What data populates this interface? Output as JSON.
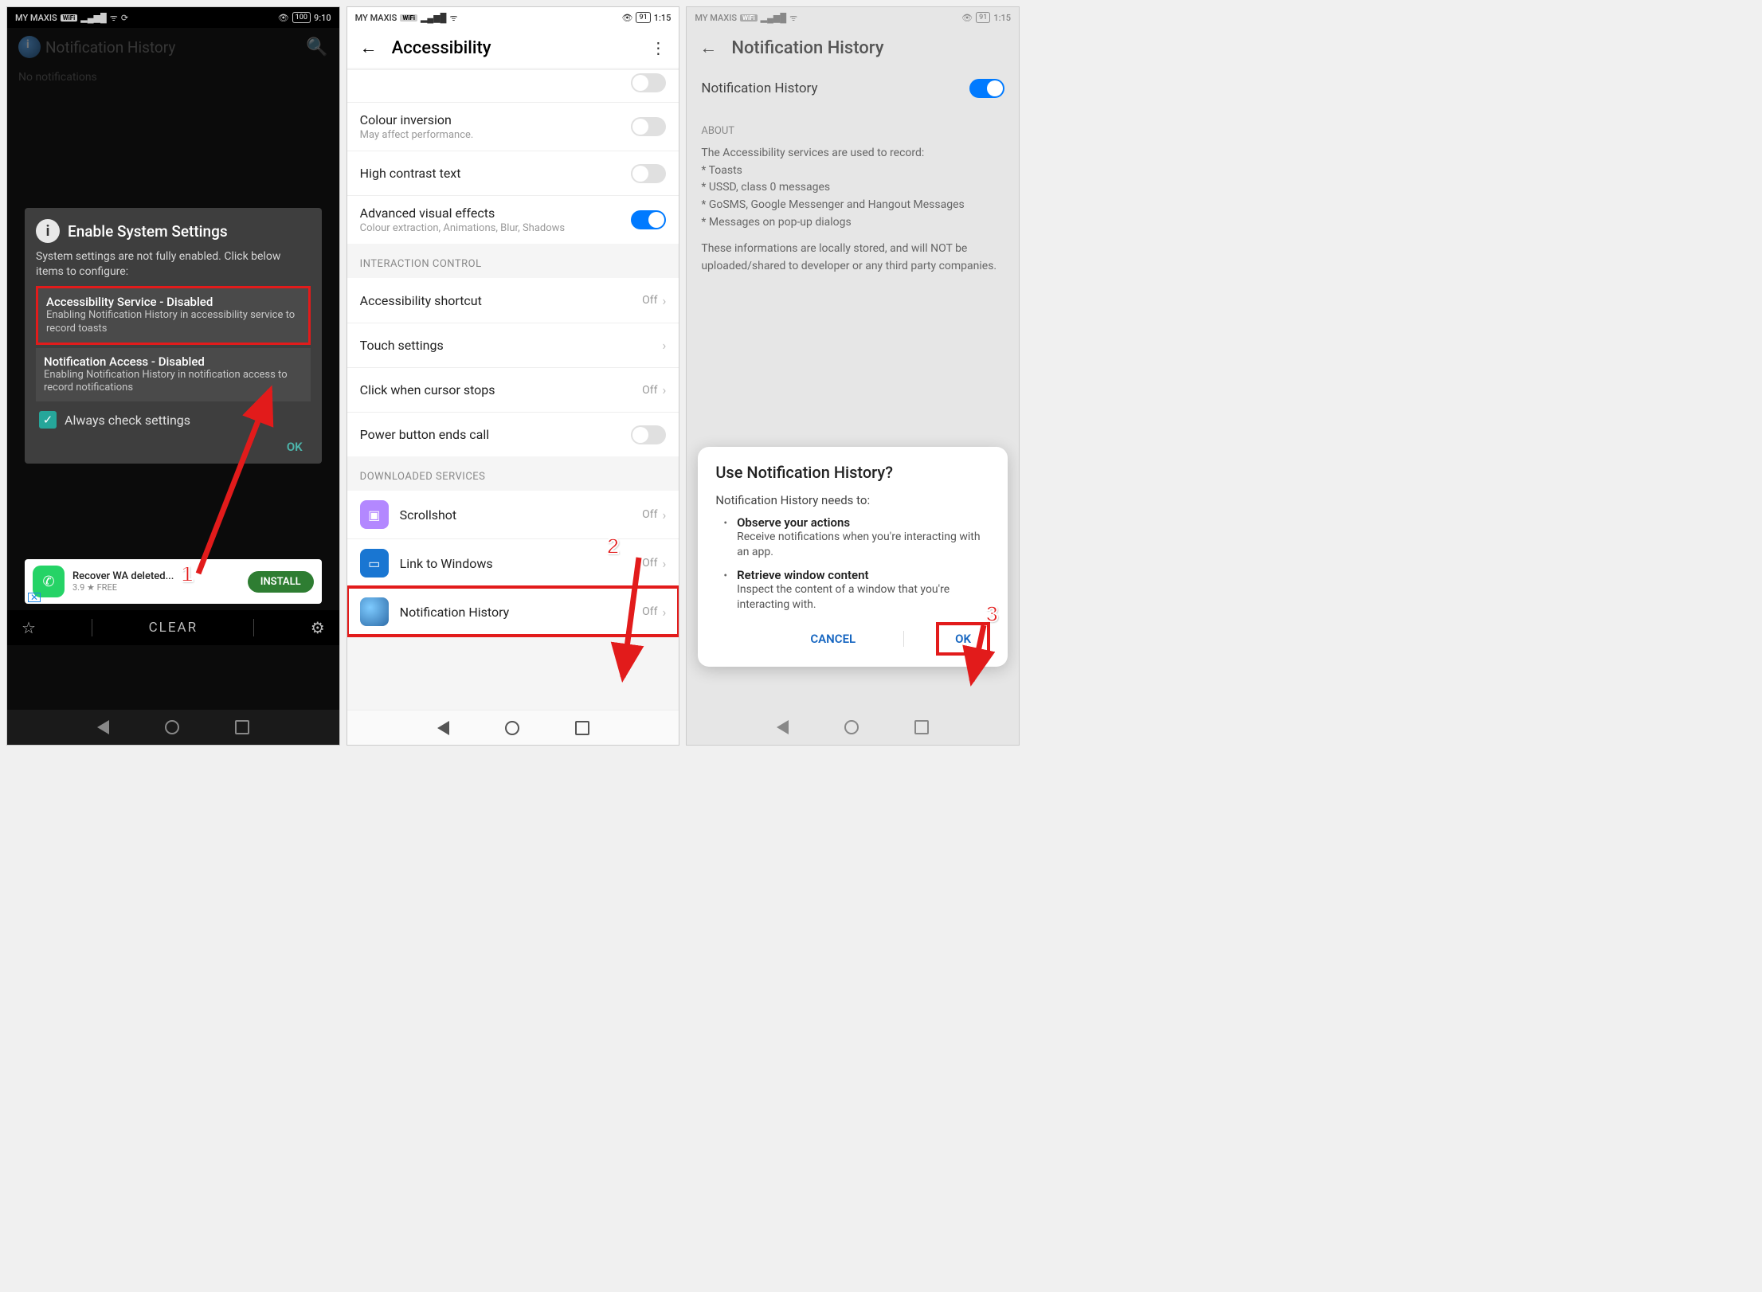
{
  "status": {
    "carrier": "MY MAXIS",
    "wifi_badge": "WiFi",
    "time1": "9:10",
    "time2": "1:15",
    "time3": "1:15",
    "battery1": "100",
    "battery2": "91",
    "battery3": "91"
  },
  "screen1": {
    "app_title": "Notification History",
    "empty_text": "No notifications",
    "dialog": {
      "title": "Enable System Settings",
      "subtitle": "System settings are not fully enabled. Click below items to configure:",
      "items": [
        {
          "title": "Accessibility Service - Disabled",
          "sub": "Enabling Notification History in accessibility service to record toasts"
        },
        {
          "title": "Notification Access - Disabled",
          "sub": "Enabling Notification History in notification access to record notifications"
        }
      ],
      "checkbox_label": "Always check settings",
      "ok": "OK"
    },
    "ad": {
      "title": "Recover WA deleted...",
      "sub": "3.9 ★ FREE",
      "button": "INSTALL"
    },
    "footer": {
      "clear": "CLEAR"
    },
    "annotation": "1"
  },
  "screen2": {
    "title": "Accessibility",
    "items_top": [
      {
        "title": "Colour inversion",
        "sub": "May affect performance.",
        "ctrl": "switch-off"
      },
      {
        "title": "High contrast text",
        "sub": "",
        "ctrl": "switch-off"
      },
      {
        "title": "Advanced visual effects",
        "sub": "Colour extraction, Animations, Blur, Shadows",
        "ctrl": "switch-on"
      }
    ],
    "section_interaction": "INTERACTION CONTROL",
    "items_interaction": [
      {
        "title": "Accessibility shortcut",
        "status": "Off",
        "ctrl": "chev"
      },
      {
        "title": "Touch settings",
        "status": "",
        "ctrl": "chev"
      },
      {
        "title": "Click when cursor stops",
        "status": "Off",
        "ctrl": "chev"
      },
      {
        "title": "Power button ends call",
        "status": "",
        "ctrl": "switch-off"
      }
    ],
    "section_downloaded": "DOWNLOADED SERVICES",
    "services": [
      {
        "title": "Scrollshot",
        "status": "Off"
      },
      {
        "title": "Link to Windows",
        "status": "Off"
      },
      {
        "title": "Notification History",
        "status": "Off"
      }
    ],
    "annotation": "2"
  },
  "screen3": {
    "title": "Notification History",
    "toggle_label": "Notification History",
    "about_header": "ABOUT",
    "about_lead": "The Accessibility services are used to record:",
    "about_bullets": [
      "* Toasts",
      "* USSD, class 0 messages",
      "* GoSMS, Google Messenger and Hangout Messages",
      "* Messages on pop-up dialogs"
    ],
    "about_footer": "These informations are locally stored, and will NOT be uploaded/shared to developer or any third party companies.",
    "dialog": {
      "title": "Use Notification History?",
      "lead": "Notification History needs to:",
      "items": [
        {
          "title": "Observe your actions",
          "sub": "Receive notifications when you're interacting with an app."
        },
        {
          "title": "Retrieve window content",
          "sub": "Inspect the content of a window that you're interacting with."
        }
      ],
      "cancel": "CANCEL",
      "ok": "OK"
    },
    "annotation": "3"
  }
}
